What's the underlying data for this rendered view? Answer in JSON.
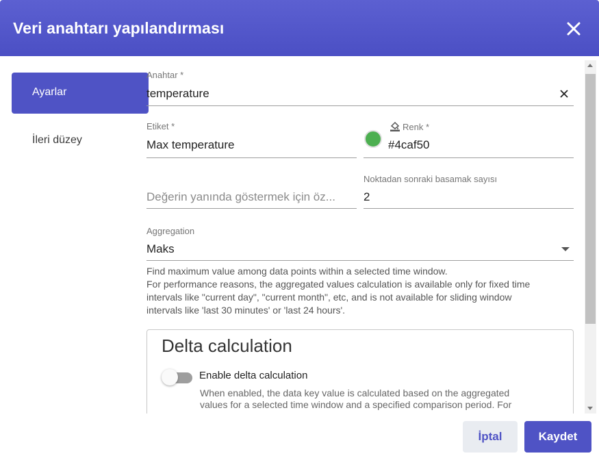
{
  "dialog": {
    "title": "Veri anahtarı yapılandırması"
  },
  "nav": {
    "items": [
      {
        "label": "Ayarlar",
        "active": true
      },
      {
        "label": "İleri düzey",
        "active": false
      }
    ]
  },
  "form": {
    "key": {
      "label": "Anahtar *",
      "value": "temperature"
    },
    "label_field": {
      "label": "Etiket *",
      "value": "Max temperature"
    },
    "color": {
      "label": "Renk *",
      "value": "#4caf50",
      "swatch": "#4caf50"
    },
    "units": {
      "placeholder": "Değerin yanında göstermek için öz..."
    },
    "decimals": {
      "label": "Noktadan sonraki basamak sayısı",
      "value": "2"
    },
    "aggregation": {
      "label": "Aggregation",
      "value": "Maks",
      "hint_lines": [
        "Find maximum value among data points within a selected time window.",
        "For performance reasons, the aggregated values calculation is available only for fixed time",
        "intervals like \"current day\", \"current month\", etc, and is not available for sliding window",
        "intervals like 'last 30 minutes' or 'last 24 hours'."
      ]
    },
    "delta": {
      "title": "Delta calculation",
      "toggle_label": "Enable delta calculation",
      "toggle_on": false,
      "desc_lines": [
        "When enabled, the data key value is calculated based on the aggregated",
        "values for a selected time window and a specified comparison period. For"
      ]
    }
  },
  "actions": {
    "cancel_label": "İptal",
    "save_label": "Kaydet"
  },
  "colors": {
    "primary": "#4f53c5",
    "header": "#5356c9",
    "swatch": "#4caf50"
  }
}
